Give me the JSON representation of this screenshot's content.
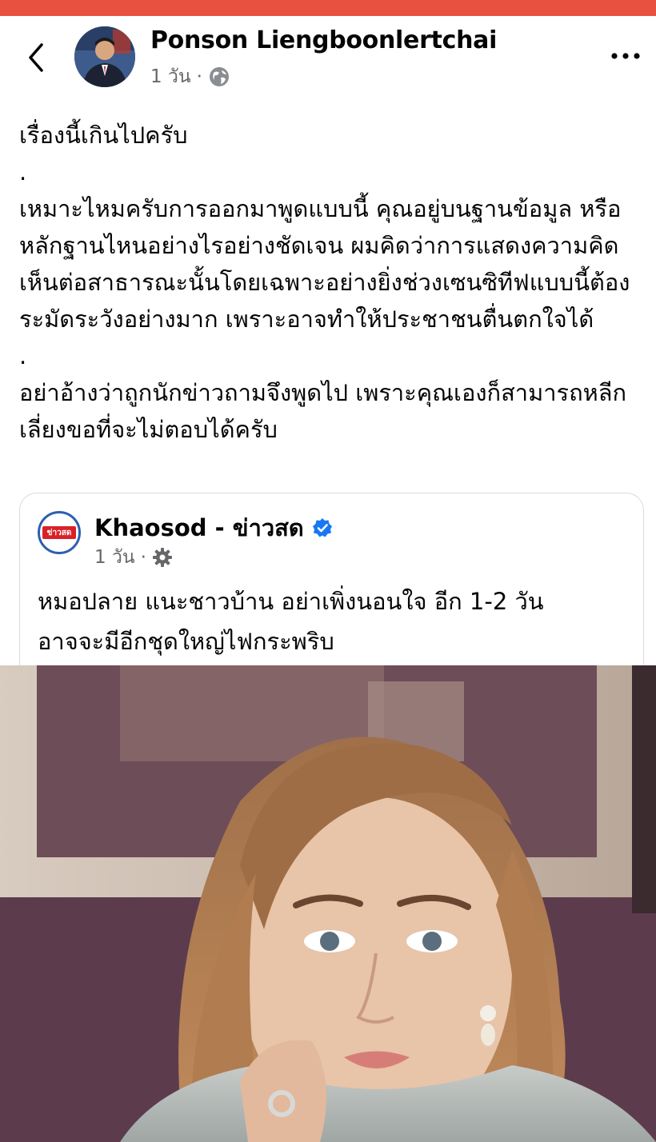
{
  "post": {
    "author": "Ponson Liengboonlertchai",
    "time": "1 วัน",
    "separator": "·",
    "paragraphs": [
      "เรื่องนี้เกินไปครับ",
      ".",
      "เหมาะไหมครับการออกมาพูดแบบนี้ คุณอยู่บนฐานข้อมูล หรือหลักฐานไหนอย่างไรอย่างชัดเจน ผมคิดว่าการแสดงความคิดเห็นต่อสาธารณะนั้นโดยเฉพาะอย่างยิ่งช่วงเซนซิทีฟแบบนี้ต้องระมัดระวังอย่างมาก เพราะอาจทำให้ประชาชนตื่นตกใจได้",
      ".",
      "อย่าอ้างว่าถูกนักข่าวถามจึงพูดไป เพราะคุณเองก็สามารถหลีกเลี่ยงขอที่จะไม่ตอบได้ครับ"
    ]
  },
  "shared": {
    "page_name": "Khaosod - ข่าวสด",
    "logo_text": "ข่าวสด",
    "time": "1 วัน",
    "separator": "·",
    "lines": [
      "หมอปลาย แนะชาวบ้าน อย่าเพิ่งนอนใจ อีก 1-2 วัน",
      "อาจจะมีอีกชุดใหญ่ไฟกระพริบ"
    ]
  },
  "colors": {
    "top_strip": "#e8513f",
    "meta_text": "#65676b",
    "verified": "#1877f2"
  },
  "icons": [
    "back-arrow-icon",
    "globe-icon",
    "more-icon",
    "verified-badge-icon",
    "gear-icon"
  ]
}
